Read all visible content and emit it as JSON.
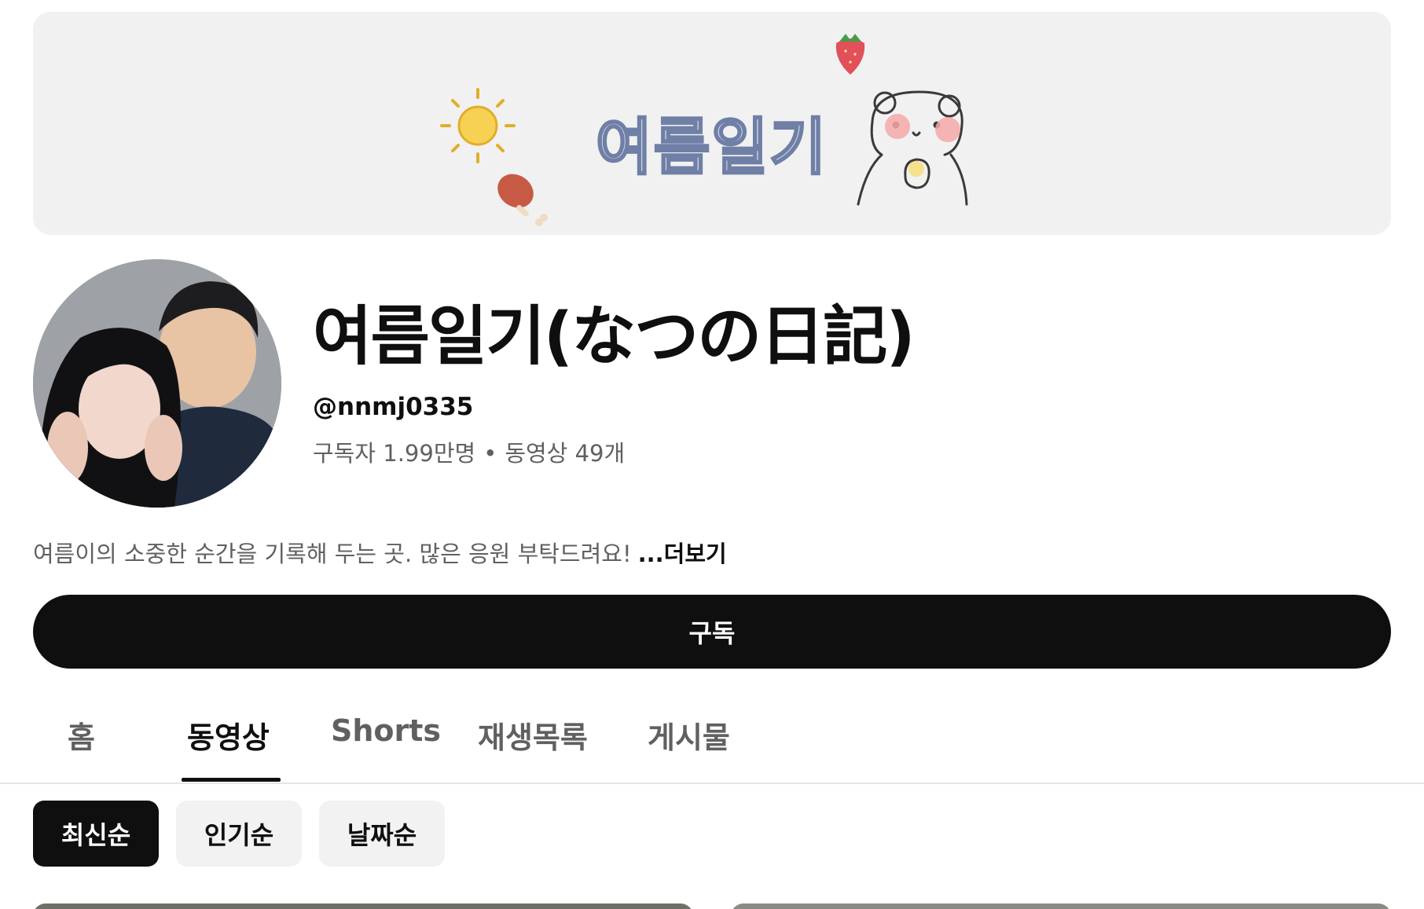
{
  "banner": {
    "title": "여름일기",
    "colors": {
      "background": "#f1f1f1",
      "title_fill": "#f4f6fb",
      "title_outline": "#6f7fa6"
    },
    "decorations": [
      "sun-icon",
      "strawberry-icon",
      "drumstick-icon",
      "bear-illustration"
    ]
  },
  "channel": {
    "name": "여름일기(なつの日記)",
    "handle": "@nnmj0335",
    "subscribers": "구독자 1.99만명",
    "separator": "•",
    "videos": "동영상 49개",
    "description": "여름이의 소중한 순간을 기록해 두는 곳. 많은 응원 부탁드려요!",
    "more_label": "...더보기"
  },
  "subscribe": {
    "label": "구독",
    "color": "#0f0f0f"
  },
  "tabs": [
    {
      "label": "홈",
      "active": false
    },
    {
      "label": "동영상",
      "active": true
    },
    {
      "label": "Shorts",
      "active": false
    },
    {
      "label": "재생목록",
      "active": false
    },
    {
      "label": "게시물",
      "active": false
    }
  ],
  "chips": [
    {
      "label": "최신순",
      "active": true
    },
    {
      "label": "인기순",
      "active": false
    },
    {
      "label": "날짜순",
      "active": false
    }
  ]
}
